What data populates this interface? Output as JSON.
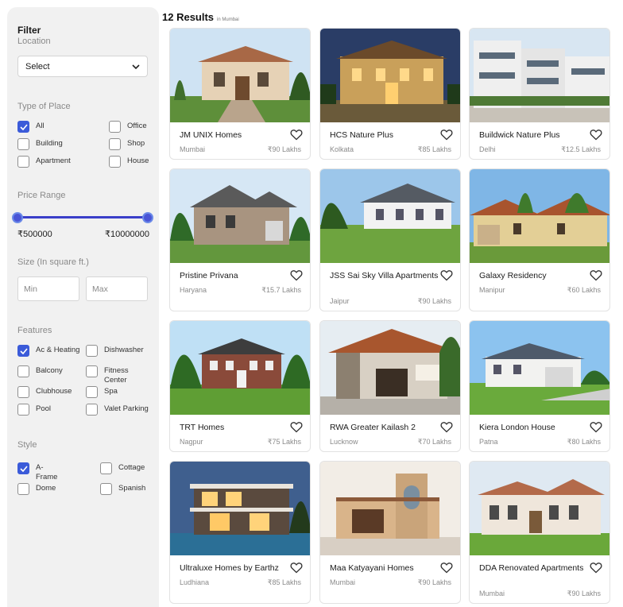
{
  "filter": {
    "title": "Filter",
    "location": {
      "label": "Location",
      "select_value": "Select"
    },
    "type_of_place": {
      "label": "Type of Place",
      "options": [
        {
          "label": "All",
          "checked": true
        },
        {
          "label": "Office",
          "checked": false
        },
        {
          "label": "Building",
          "checked": false
        },
        {
          "label": "Shop",
          "checked": false
        },
        {
          "label": "Apartment",
          "checked": false
        },
        {
          "label": "House",
          "checked": false
        }
      ]
    },
    "price_range": {
      "label": "Price Range",
      "min": "₹500000",
      "max": "₹10000000"
    },
    "size": {
      "label": "Size (In square ft.)",
      "min_placeholder": "Min",
      "max_placeholder": "Max"
    },
    "features": {
      "label": "Features",
      "options": [
        {
          "label": "Ac & Heating",
          "checked": true
        },
        {
          "label": "Dishwasher",
          "checked": false
        },
        {
          "label": "Balcony",
          "checked": false
        },
        {
          "label": "Fitness Center",
          "checked": false
        },
        {
          "label": "Clubhouse",
          "checked": false
        },
        {
          "label": "Spa",
          "checked": false
        },
        {
          "label": "Pool",
          "checked": false
        },
        {
          "label": "Valet Parking",
          "checked": false
        }
      ]
    },
    "style": {
      "label": "Style",
      "options": [
        {
          "label": "A-Frame",
          "checked": true
        },
        {
          "label": "Cottage",
          "checked": false
        },
        {
          "label": "Dome",
          "checked": false
        },
        {
          "label": "Spanish",
          "checked": false
        }
      ]
    }
  },
  "results": {
    "count_label": "12 Results",
    "location_hint": "in Mumbai"
  },
  "colors": {
    "accent": "#3b5bd9",
    "sidebar_bg": "#f1f1f1"
  },
  "listings": [
    {
      "name": "JM UNIX Homes",
      "location": "Mumbai",
      "price": "₹90 Lakhs"
    },
    {
      "name": "HCS Nature Plus",
      "location": "Kolkata",
      "price": "₹85 Lakhs"
    },
    {
      "name": "Buildwick Nature Plus",
      "location": "Delhi",
      "price": "₹12.5 Lakhs"
    },
    {
      "name": "Pristine Privana",
      "location": "Haryana",
      "price": "₹15.7 Lakhs"
    },
    {
      "name": "JSS Sai Sky Villa Apartments",
      "location": "Jaipur",
      "price": "₹90 Lakhs"
    },
    {
      "name": "Galaxy Residency",
      "location": "Manipur",
      "price": "₹60 Lakhs"
    },
    {
      "name": "TRT Homes",
      "location": "Nagpur",
      "price": "₹75 Lakhs"
    },
    {
      "name": "RWA Greater Kailash 2",
      "location": "Lucknow",
      "price": "₹70 Lakhs"
    },
    {
      "name": "Kiera London House",
      "location": "Patna",
      "price": "₹80 Lakhs"
    },
    {
      "name": "Ultraluxe Homes by Earthz",
      "location": "Ludhiana",
      "price": "₹85 Lakhs"
    },
    {
      "name": "Maa Katyayani Homes",
      "location": "Mumbai",
      "price": "₹90 Lakhs"
    },
    {
      "name": "DDA Renovated Apartments",
      "location": "Mumbai",
      "price": "₹90 Lakhs"
    }
  ]
}
